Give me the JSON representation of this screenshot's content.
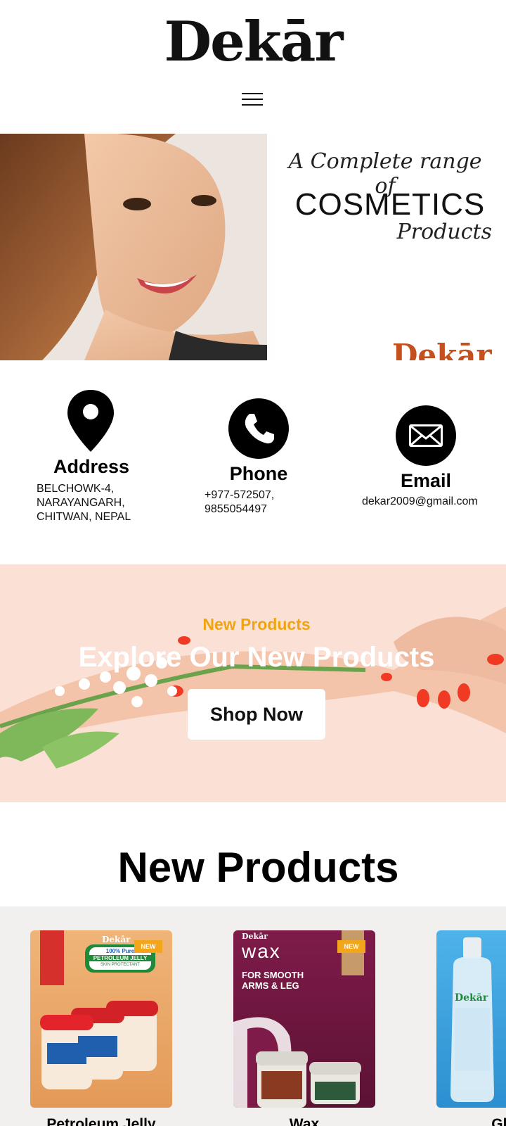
{
  "brand": {
    "logo_text": "Dekār"
  },
  "nav": {
    "menu_icon": "hamburger-menu-icon"
  },
  "hero": {
    "tagline": "A Complete range of",
    "headline": "COSMETICS",
    "subline": "Products",
    "brand_mark": "Dekār"
  },
  "contact": {
    "address": {
      "icon": "map-pin-icon",
      "title": "Address",
      "text": "BELCHOWK-4,\nNARAYANGARH,\nCHITWAN, NEPAL"
    },
    "phone": {
      "icon": "phone-icon",
      "title": "Phone",
      "text": "+977-572507,\n9855054497"
    },
    "email": {
      "icon": "mail-icon",
      "title": "Email",
      "text": "dekar2009@gmail.com"
    }
  },
  "promo": {
    "eyebrow": "New Products",
    "title": "Explore Our New Products",
    "button_label": "Shop Now"
  },
  "new_products": {
    "heading": "New Products",
    "items": [
      {
        "name": "Petroleum Jelly",
        "badge": "NEW",
        "label_line1": "100% Pure",
        "label_line2": "PETROLEUM JELLY",
        "label_line3": "SKIN PROTECTANT",
        "brand": "Dekār"
      },
      {
        "name": "Wax",
        "badge": "NEW",
        "label_line1": "wax",
        "label_line2": "FOR SMOOTH",
        "label_line3": "ARMS & LEG",
        "brand": "Dekār"
      },
      {
        "name": "Glyc",
        "label_line1": "Dekār"
      }
    ]
  },
  "colors": {
    "promo_bg": "#fbe0d6",
    "accent": "#f0a412",
    "products_bg": "#f1f0ef",
    "jelly_card": "#e8a866",
    "wax_card": "#7a1a44",
    "glycerin_card": "#45a8e0"
  }
}
